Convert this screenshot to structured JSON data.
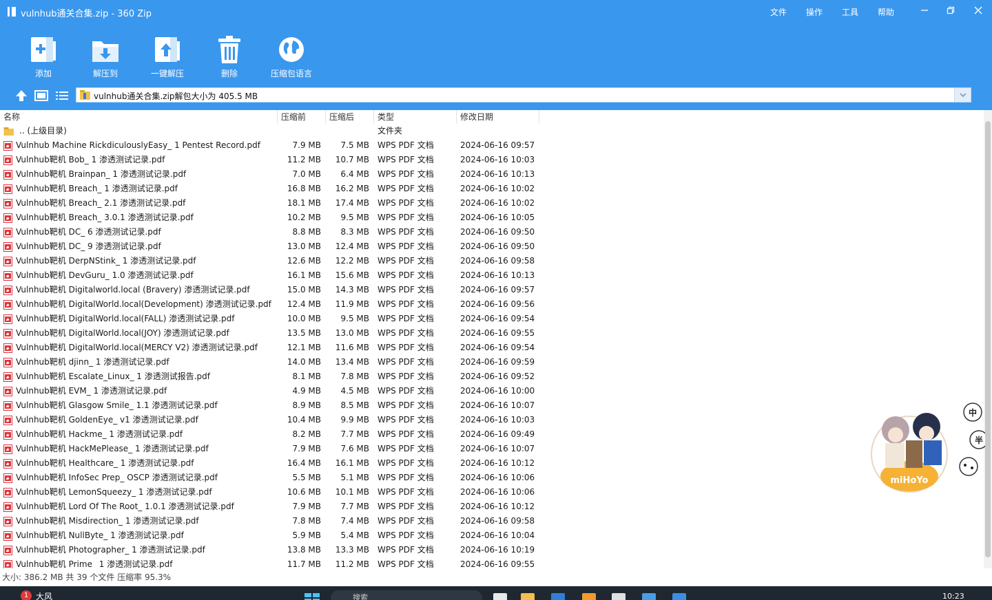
{
  "window": {
    "title": "vulnhub通关合集.zip - 360 Zip",
    "menus": [
      "文件",
      "操作",
      "工具",
      "帮助"
    ]
  },
  "toolbar": {
    "add_label": "添加",
    "extract_to_label": "解压到",
    "one_click_label": "一键解压",
    "delete_label": "删除",
    "language_label": "压缩包语言"
  },
  "address": {
    "path_text": "vulnhub通关合集.zip解包大小为 405.5 MB"
  },
  "columns": {
    "name": "名称",
    "size": "压缩前",
    "compressed": "压缩后",
    "type": "类型",
    "modified": "修改日期"
  },
  "parent": {
    "name": ".. (上级目录)",
    "type": "文件夹"
  },
  "files": [
    {
      "name": "Vulnhub Machine RickdiculouslyEasy_ 1 Pentest Record.pdf",
      "size": "7.9 MB",
      "compressed": "7.5 MB",
      "type": "WPS PDF 文档",
      "modified": "2024-06-16 09:57"
    },
    {
      "name": "Vulnhub靶机 Bob_ 1 渗透测试记录.pdf",
      "size": "11.2 MB",
      "compressed": "10.7 MB",
      "type": "WPS PDF 文档",
      "modified": "2024-06-16 10:03"
    },
    {
      "name": "Vulnhub靶机 Brainpan_ 1 渗透测试记录.pdf",
      "size": "7.0 MB",
      "compressed": "6.4 MB",
      "type": "WPS PDF 文档",
      "modified": "2024-06-16 10:13"
    },
    {
      "name": "Vulnhub靶机 Breach_ 1 渗透测试记录.pdf",
      "size": "16.8 MB",
      "compressed": "16.2 MB",
      "type": "WPS PDF 文档",
      "modified": "2024-06-16 10:02"
    },
    {
      "name": "Vulnhub靶机 Breach_ 2.1 渗透测试记录.pdf",
      "size": "18.1 MB",
      "compressed": "17.4 MB",
      "type": "WPS PDF 文档",
      "modified": "2024-06-16 10:02"
    },
    {
      "name": "Vulnhub靶机 Breach_ 3.0.1 渗透测试记录.pdf",
      "size": "10.2 MB",
      "compressed": "9.5 MB",
      "type": "WPS PDF 文档",
      "modified": "2024-06-16 10:05"
    },
    {
      "name": "Vulnhub靶机 DC_ 6 渗透测试记录.pdf",
      "size": "8.8 MB",
      "compressed": "8.3 MB",
      "type": "WPS PDF 文档",
      "modified": "2024-06-16 09:50"
    },
    {
      "name": "Vulnhub靶机 DC_ 9 渗透测试记录.pdf",
      "size": "13.0 MB",
      "compressed": "12.4 MB",
      "type": "WPS PDF 文档",
      "modified": "2024-06-16 09:50"
    },
    {
      "name": "Vulnhub靶机 DerpNStink_ 1 渗透测试记录.pdf",
      "size": "12.6 MB",
      "compressed": "12.2 MB",
      "type": "WPS PDF 文档",
      "modified": "2024-06-16 09:58"
    },
    {
      "name": "Vulnhub靶机 DevGuru_ 1.0 渗透测试记录.pdf",
      "size": "16.1 MB",
      "compressed": "15.6 MB",
      "type": "WPS PDF 文档",
      "modified": "2024-06-16 10:13"
    },
    {
      "name": "Vulnhub靶机 Digitalworld.local (Bravery) 渗透测试记录.pdf",
      "size": "15.0 MB",
      "compressed": "14.3 MB",
      "type": "WPS PDF 文档",
      "modified": "2024-06-16 09:57"
    },
    {
      "name": "Vulnhub靶机 DigitalWorld.local(Development) 渗透测试记录.pdf",
      "size": "12.4 MB",
      "compressed": "11.9 MB",
      "type": "WPS PDF 文档",
      "modified": "2024-06-16 09:56"
    },
    {
      "name": "Vulnhub靶机 DigitalWorld.local(FALL) 渗透测试记录.pdf",
      "size": "10.0 MB",
      "compressed": "9.5 MB",
      "type": "WPS PDF 文档",
      "modified": "2024-06-16 09:54"
    },
    {
      "name": "Vulnhub靶机 DigitalWorld.local(JOY) 渗透测试记录.pdf",
      "size": "13.5 MB",
      "compressed": "13.0 MB",
      "type": "WPS PDF 文档",
      "modified": "2024-06-16 09:55"
    },
    {
      "name": "Vulnhub靶机 DigitalWorld.local(MERCY V2) 渗透测试记录.pdf",
      "size": "12.1 MB",
      "compressed": "11.6 MB",
      "type": "WPS PDF 文档",
      "modified": "2024-06-16 09:54"
    },
    {
      "name": "Vulnhub靶机 djinn_ 1 渗透测试记录.pdf",
      "size": "14.0 MB",
      "compressed": "13.4 MB",
      "type": "WPS PDF 文档",
      "modified": "2024-06-16 09:59"
    },
    {
      "name": "Vulnhub靶机 Escalate_Linux_ 1 渗透测试报告.pdf",
      "size": "8.1 MB",
      "compressed": "7.8 MB",
      "type": "WPS PDF 文档",
      "modified": "2024-06-16 09:52"
    },
    {
      "name": "Vulnhub靶机 EVM_ 1 渗透测试记录.pdf",
      "size": "4.9 MB",
      "compressed": "4.5 MB",
      "type": "WPS PDF 文档",
      "modified": "2024-06-16 10:00"
    },
    {
      "name": "Vulnhub靶机 Glasgow Smile_ 1.1 渗透测试记录.pdf",
      "size": "8.9 MB",
      "compressed": "8.5 MB",
      "type": "WPS PDF 文档",
      "modified": "2024-06-16 10:07"
    },
    {
      "name": "Vulnhub靶机 GoldenEye_ v1 渗透测试记录.pdf",
      "size": "10.4 MB",
      "compressed": "9.9 MB",
      "type": "WPS PDF 文档",
      "modified": "2024-06-16 10:03"
    },
    {
      "name": "Vulnhub靶机 Hackme_ 1 渗透测试记录.pdf",
      "size": "8.2 MB",
      "compressed": "7.7 MB",
      "type": "WPS PDF 文档",
      "modified": "2024-06-16 09:49"
    },
    {
      "name": "Vulnhub靶机 HackMePlease_ 1 渗透测试记录.pdf",
      "size": "7.9 MB",
      "compressed": "7.6 MB",
      "type": "WPS PDF 文档",
      "modified": "2024-06-16 10:07"
    },
    {
      "name": "Vulnhub靶机 Healthcare_ 1 渗透测试记录.pdf",
      "size": "16.4 MB",
      "compressed": "16.1 MB",
      "type": "WPS PDF 文档",
      "modified": "2024-06-16 10:12"
    },
    {
      "name": "Vulnhub靶机 InfoSec Prep_ OSCP 渗透测试记录.pdf",
      "size": "5.5 MB",
      "compressed": "5.1 MB",
      "type": "WPS PDF 文档",
      "modified": "2024-06-16 10:06"
    },
    {
      "name": "Vulnhub靶机 LemonSqueezy_ 1 渗透测试记录.pdf",
      "size": "10.6 MB",
      "compressed": "10.1 MB",
      "type": "WPS PDF 文档",
      "modified": "2024-06-16 10:06"
    },
    {
      "name": "Vulnhub靶机 Lord Of The Root_ 1.0.1 渗透测试记录.pdf",
      "size": "7.9 MB",
      "compressed": "7.7 MB",
      "type": "WPS PDF 文档",
      "modified": "2024-06-16 10:12"
    },
    {
      "name": "Vulnhub靶机 Misdirection_ 1 渗透测试记录.pdf",
      "size": "7.8 MB",
      "compressed": "7.4 MB",
      "type": "WPS PDF 文档",
      "modified": "2024-06-16 09:58"
    },
    {
      "name": "Vulnhub靶机 NullByte_ 1 渗透测试记录.pdf",
      "size": "5.9 MB",
      "compressed": "5.4 MB",
      "type": "WPS PDF 文档",
      "modified": "2024-06-16 10:04"
    },
    {
      "name": "Vulnhub靶机 Photographer_ 1 渗透测试记录.pdf",
      "size": "13.8 MB",
      "compressed": "13.3 MB",
      "type": "WPS PDF 文档",
      "modified": "2024-06-16 10:19"
    },
    {
      "name": "Vulnhub靶机 Prime_ 1 渗透测试记录.pdf",
      "size": "11.7 MB",
      "compressed": "11.2 MB",
      "type": "WPS PDF 文档",
      "modified": "2024-06-16 09:55"
    }
  ],
  "status": {
    "text": "大小: 386.2 MB 共 39 个文件 压缩率 95.3%"
  },
  "mascot": {
    "badges": [
      "中",
      "半"
    ],
    "logo_text": "miHoYo"
  },
  "taskbar": {
    "notification_count": "1",
    "weather_text": "大风",
    "search_placeholder": "搜索",
    "time": "10:23"
  },
  "colors": {
    "accent": "#3a97ee",
    "pdf_icon": "#d9363e",
    "folder": "#f2c14e"
  }
}
